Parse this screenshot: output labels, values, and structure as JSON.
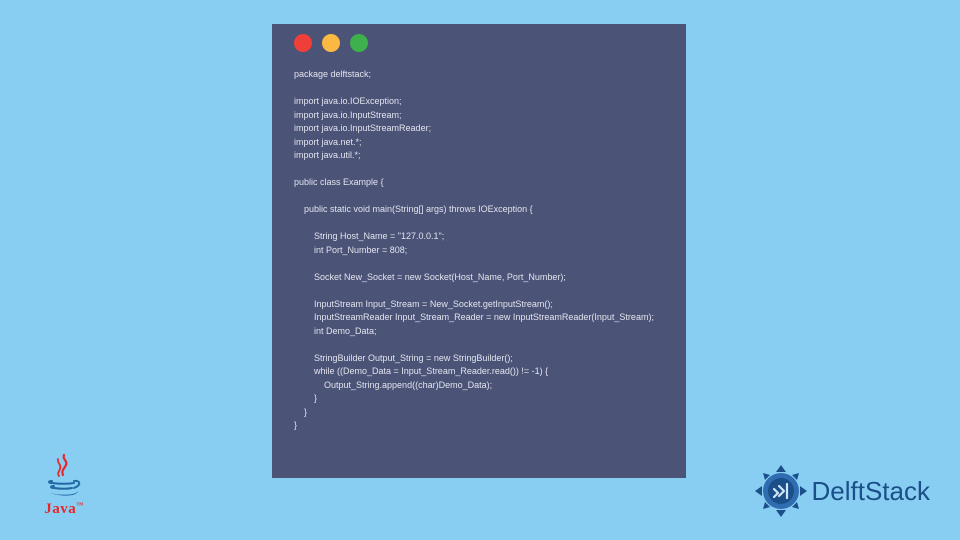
{
  "code_window": {
    "dots": [
      "red",
      "yellow",
      "green"
    ],
    "code": "package delftstack;\n\nimport java.io.IOException;\nimport java.io.InputStream;\nimport java.io.InputStreamReader;\nimport java.net.*;\nimport java.util.*;\n\npublic class Example {\n\n    public static void main(String[] args) throws IOException {\n\n        String Host_Name = \"127.0.0.1\";\n        int Port_Number = 808;\n\n        Socket New_Socket = new Socket(Host_Name, Port_Number);\n\n        InputStream Input_Stream = New_Socket.getInputStream();\n        InputStreamReader Input_Stream_Reader = new InputStreamReader(Input_Stream);\n        int Demo_Data;\n\n        StringBuilder Output_String = new StringBuilder();\n        while ((Demo_Data = Input_Stream_Reader.read()) != -1) {\n            Output_String.append((char)Demo_Data);\n        }\n    }\n}"
  },
  "logos": {
    "java": {
      "label": "Java",
      "tm": "™"
    },
    "delftstack": {
      "label": "DelftStack"
    }
  },
  "colors": {
    "bg": "#88cef2",
    "window": "#4b5377",
    "code_text": "#e2e4ee",
    "dot_red": "#f03f38",
    "dot_yellow": "#fbb843",
    "dot_green": "#3cb14c",
    "java_red": "#e7272c",
    "java_blue": "#1f6aa3",
    "delft_blue": "#1a4f89",
    "delft_accent": "#2f6db0"
  }
}
